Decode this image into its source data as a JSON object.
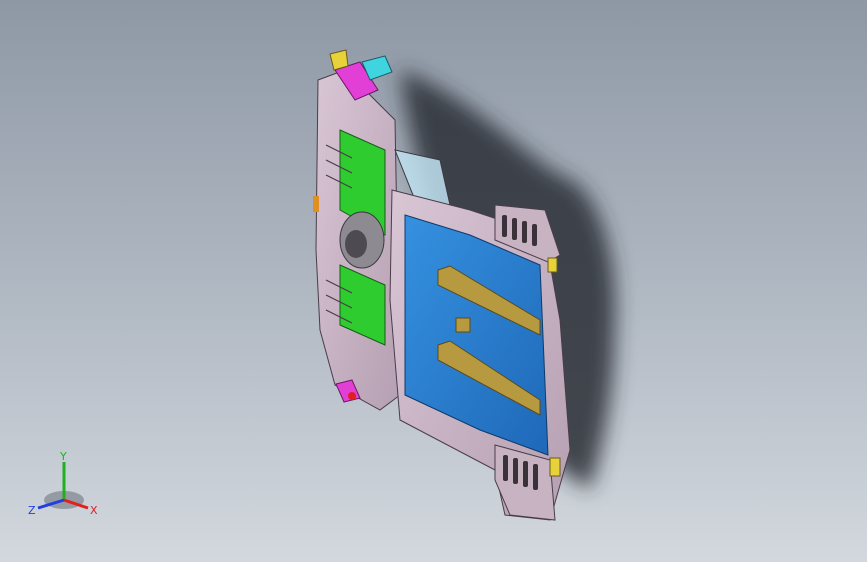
{
  "viewport": {
    "model_colors": {
      "body_panel": "#c8b3c3",
      "bracket_green": "#2ecc2e",
      "floor_blue": "#2a7fd4",
      "rail_gold": "#b79a3f",
      "accent_magenta": "#e23fd6",
      "accent_cyan": "#3fd4e0",
      "accent_yellow": "#e8d23a",
      "shadow": "#2b2f36"
    }
  },
  "triad": {
    "x_label": "X",
    "y_label": "Y",
    "z_label": "Z",
    "x_color": "#e02020",
    "y_color": "#20b020",
    "z_color": "#2040e0"
  }
}
